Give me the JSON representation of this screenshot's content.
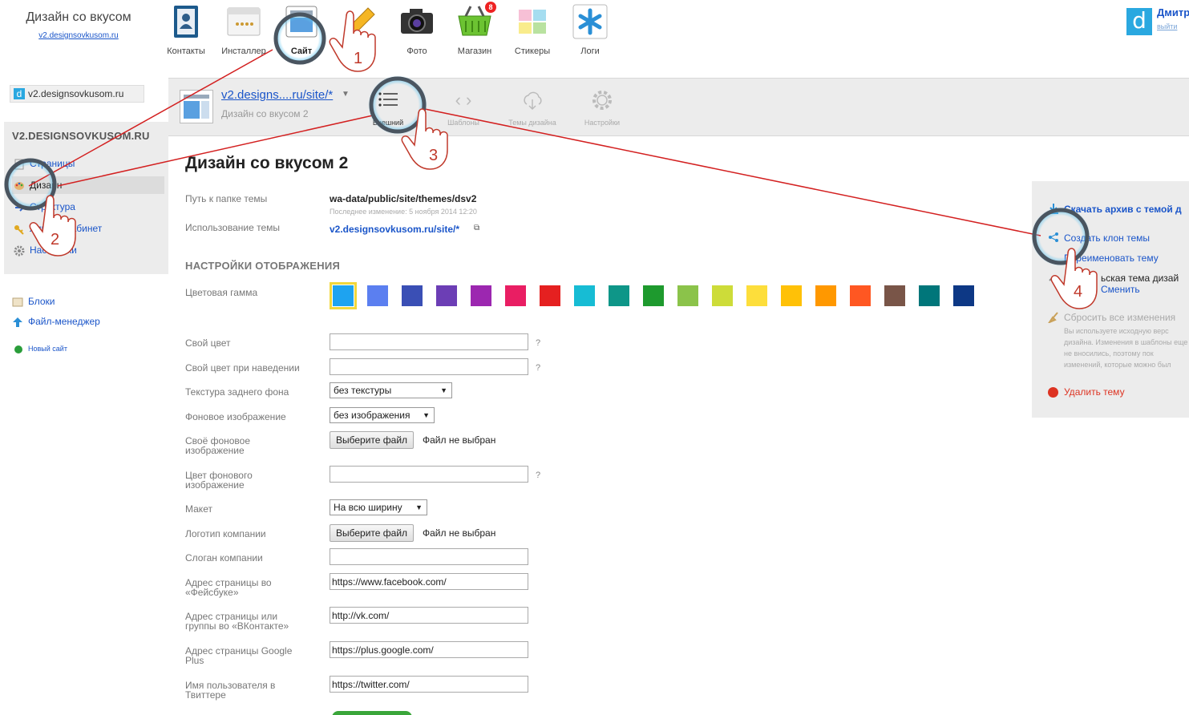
{
  "brand": {
    "name": "Дизайн со вкусом",
    "url": "v2.designsovkusom.ru"
  },
  "apps": [
    {
      "label": "Контакты",
      "icon": "contacts-icon"
    },
    {
      "label": "Инсталлер",
      "icon": "installer-icon"
    },
    {
      "label": "Сайт",
      "icon": "site-icon"
    },
    {
      "label": "Фото",
      "icon": "camera-icon"
    },
    {
      "label": "Магазин",
      "icon": "basket-icon",
      "badge": "8"
    },
    {
      "label": "Стикеры",
      "icon": "stickers-icon"
    },
    {
      "label": "Логи",
      "icon": "logs-icon"
    }
  ],
  "user": {
    "name": "Дмитр",
    "logout": "выйти"
  },
  "sidebar": {
    "site_selector": "v2.designsovkusom.ru",
    "title": "V2.DESIGNSOVKUSOM.RU",
    "items": [
      {
        "label": "Страницы"
      },
      {
        "label": "Дизайн"
      },
      {
        "label": "Структура"
      },
      {
        "label": "Личный кабинет"
      },
      {
        "label": "Настройки"
      }
    ],
    "links": [
      {
        "label": "Блоки"
      },
      {
        "label": "Файл-менеджер"
      }
    ],
    "new_site": "Новый сайт"
  },
  "toolbar": {
    "theme_link": "v2.designs....ru/site/*",
    "theme_sub": "Дизайн со вкусом 2",
    "tabs": [
      {
        "label": "Внешний"
      },
      {
        "label": "Шаблоны"
      },
      {
        "label": "Темы дизайна"
      },
      {
        "label": "Настройки"
      }
    ]
  },
  "page": {
    "title": "Дизайн со вкусом 2",
    "path_label": "Путь к папке темы",
    "path_value": "wa-data/public/site/themes/dsv2",
    "modified": "Последнее изменение: 5 ноября 2014 12:20",
    "usage_label": "Использование темы",
    "usage_value": "v2.designsovkusom.ru/site/*",
    "section": "НАСТРОЙКИ ОТОБРАЖЕНИЯ",
    "color_label": "Цветовая гамма",
    "swatches": [
      "#1ea3f0",
      "#5b7ff0",
      "#3a4fb5",
      "#6c3eb5",
      "#9c27b0",
      "#e91e63",
      "#e52020",
      "#17bcd4",
      "#0e9688",
      "#1e9a2e",
      "#8bc34a",
      "#cddc39",
      "#fdde3b",
      "#ffc107",
      "#ff9800",
      "#ff5722",
      "#795548",
      "#00767a",
      "#0d3885"
    ],
    "fields": {
      "own_color": "Свой цвет",
      "own_hover": "Свой цвет при наведении",
      "bg_texture": "Текстура заднего фона",
      "bg_texture_value": "без текстуры",
      "bg_image": "Фоновое изображение",
      "bg_image_value": "без изображения",
      "own_bg": "Своё фоновое изображение",
      "bg_color": "Цвет фонового изображение",
      "layout": "Макет",
      "layout_value": "На всю ширину",
      "logo": "Логотип компании",
      "slogan": "Слоган компании",
      "facebook": "Адрес страницы во «Фейсбуке»",
      "facebook_value": "https://www.facebook.com/",
      "vk": "Адрес страницы или группы во «ВКонтакте»",
      "vk_value": "http://vk.com/",
      "google": "Адрес страницы Google Plus",
      "google_value": "https://plus.google.com/",
      "twitter": "Имя пользователя в Твиттере",
      "twitter_value": "https://twitter.com/"
    },
    "file_button": "Выберите файл",
    "no_file": "Файл не выбран",
    "help": "?"
  },
  "actions": {
    "download": "Скачать архив с темой д",
    "clone": "Создать клон темы",
    "rename": "Переименовать тему",
    "parent": "ьская тема дизай",
    "change": "Сменить",
    "reset": "Сбросить все изменения",
    "reset_note": "Вы используете исходную верс дизайна. Изменения в шаблоны еще не вносились, поэтому пок изменений, которые можно был",
    "delete": "Удалить тему"
  },
  "callouts": [
    "1",
    "2",
    "3",
    "4"
  ]
}
